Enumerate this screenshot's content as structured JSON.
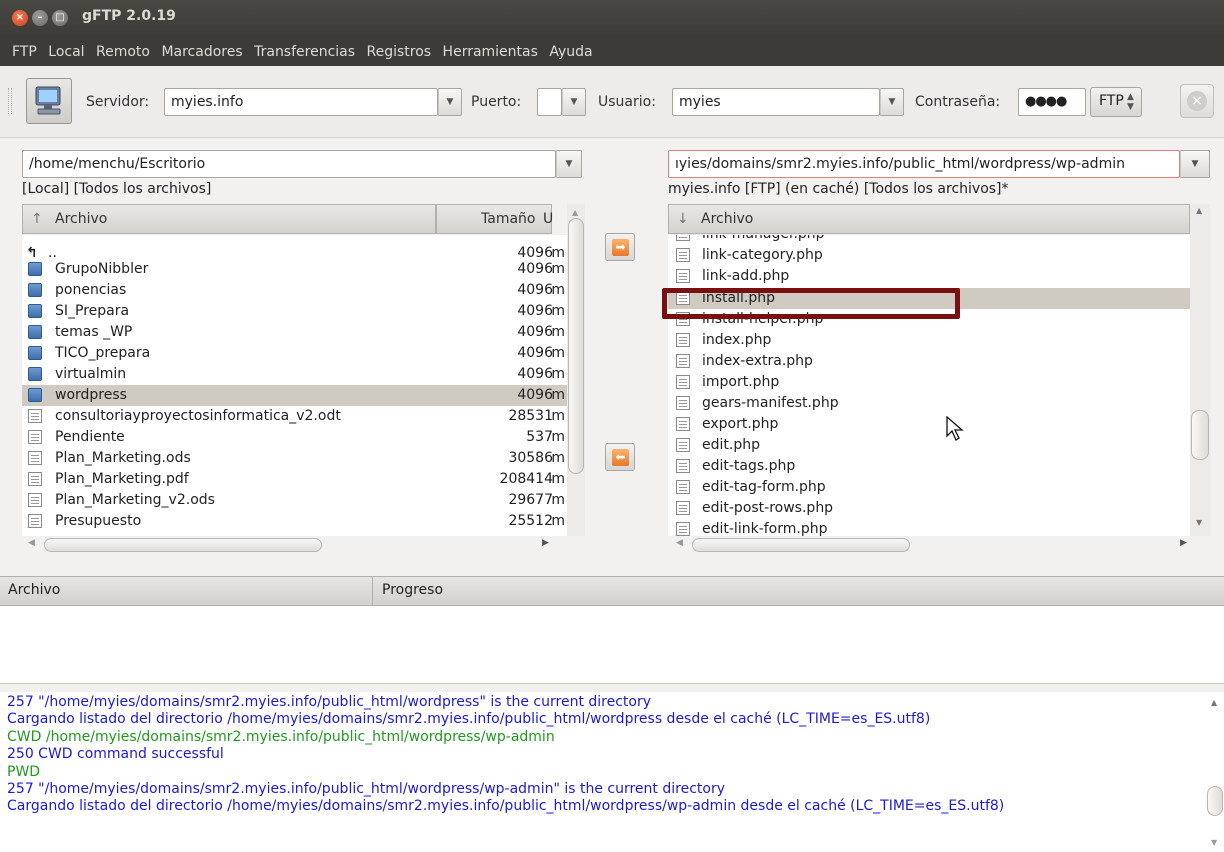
{
  "window": {
    "title": "gFTP 2.0.19"
  },
  "menu": [
    "FTP",
    "Local",
    "Remoto",
    "Marcadores",
    "Transferencias",
    "Registros",
    "Herramientas",
    "Ayuda"
  ],
  "toolbar": {
    "server_label": "Servidor:",
    "server_value": "myies.info",
    "port_label": "Puerto:",
    "port_value": "",
    "user_label": "Usuario:",
    "user_value": "myies",
    "password_label": "Contraseña:",
    "password_mask": "●●●●",
    "protocol": "FTP"
  },
  "local": {
    "path": "/home/menchu/Escritorio",
    "status": "[Local] [Todos los archivos]",
    "col_name": "Archivo",
    "col_size": "Tamaño",
    "col_extra": "U",
    "files": [
      {
        "name": "..",
        "size": "4096",
        "extra": "m",
        "type": "up"
      },
      {
        "name": "GrupoNibbler",
        "size": "4096",
        "extra": "m",
        "type": "folder"
      },
      {
        "name": "ponencias",
        "size": "4096",
        "extra": "m",
        "type": "folder"
      },
      {
        "name": "SI_Prepara",
        "size": "4096",
        "extra": "m",
        "type": "folder"
      },
      {
        "name": "temas _WP",
        "size": "4096",
        "extra": "m",
        "type": "folder"
      },
      {
        "name": "TICO_prepara",
        "size": "4096",
        "extra": "m",
        "type": "folder"
      },
      {
        "name": "virtualmin",
        "size": "4096",
        "extra": "m",
        "type": "folder"
      },
      {
        "name": "wordpress",
        "size": "4096",
        "extra": "m",
        "type": "folder"
      },
      {
        "name": "consultoriayproyectosinformatica_v2.odt",
        "size": "28531",
        "extra": "m",
        "type": "file"
      },
      {
        "name": "Pendiente",
        "size": "537",
        "extra": "m",
        "type": "file"
      },
      {
        "name": "Plan_Marketing.ods",
        "size": "30586",
        "extra": "m",
        "type": "file"
      },
      {
        "name": "Plan_Marketing.pdf",
        "size": "208414",
        "extra": "m",
        "type": "file"
      },
      {
        "name": "Plan_Marketing_v2.ods",
        "size": "29677",
        "extra": "m",
        "type": "file"
      },
      {
        "name": "Presupuesto",
        "size": "25512",
        "extra": "m",
        "type": "file"
      }
    ]
  },
  "remote": {
    "path": "ıyies/domains/smr2.myies.info/public_html/wordpress/wp-admin",
    "status": "myies.info [FTP] (en caché) [Todos los archivos]*",
    "col_name": "Archivo",
    "files": [
      {
        "name": "link-manager.php"
      },
      {
        "name": "link-category.php"
      },
      {
        "name": "link-add.php"
      },
      {
        "name": "install.php"
      },
      {
        "name": "install-helper.php"
      },
      {
        "name": "index.php"
      },
      {
        "name": "index-extra.php"
      },
      {
        "name": "import.php"
      },
      {
        "name": "gears-manifest.php"
      },
      {
        "name": "export.php"
      },
      {
        "name": "edit.php"
      },
      {
        "name": "edit-tags.php"
      },
      {
        "name": "edit-tag-form.php"
      },
      {
        "name": "edit-post-rows.php"
      },
      {
        "name": "edit-link-form.php"
      }
    ]
  },
  "transfers": {
    "col_file": "Archivo",
    "col_progress": "Progreso"
  },
  "log": [
    {
      "text": "257 \"/home/myies/domains/smr2.myies.info/public_html/wordpress\" is the current directory",
      "color": "blue"
    },
    {
      "text": "Cargando listado del directorio /home/myies/domains/smr2.myies.info/public_html/wordpress desde el caché (LC_TIME=es_ES.utf8)",
      "color": "blue"
    },
    {
      "text": "CWD /home/myies/domains/smr2.myies.info/public_html/wordpress/wp-admin",
      "color": "green"
    },
    {
      "text": "250 CWD command successful",
      "color": "blue"
    },
    {
      "text": "PWD",
      "color": "green"
    },
    {
      "text": "257 \"/home/myies/domains/smr2.myies.info/public_html/wordpress/wp-admin\" is the current directory",
      "color": "blue"
    },
    {
      "text": "Cargando listado del directorio /home/myies/domains/smr2.myies.info/public_html/wordpress/wp-admin desde el caché (LC_TIME=es_ES.utf8)",
      "color": "blue"
    }
  ],
  "colors": {
    "highlight_box": "#7a0f0f",
    "selection": "#cfcbc3",
    "accent": "#e8772d"
  }
}
